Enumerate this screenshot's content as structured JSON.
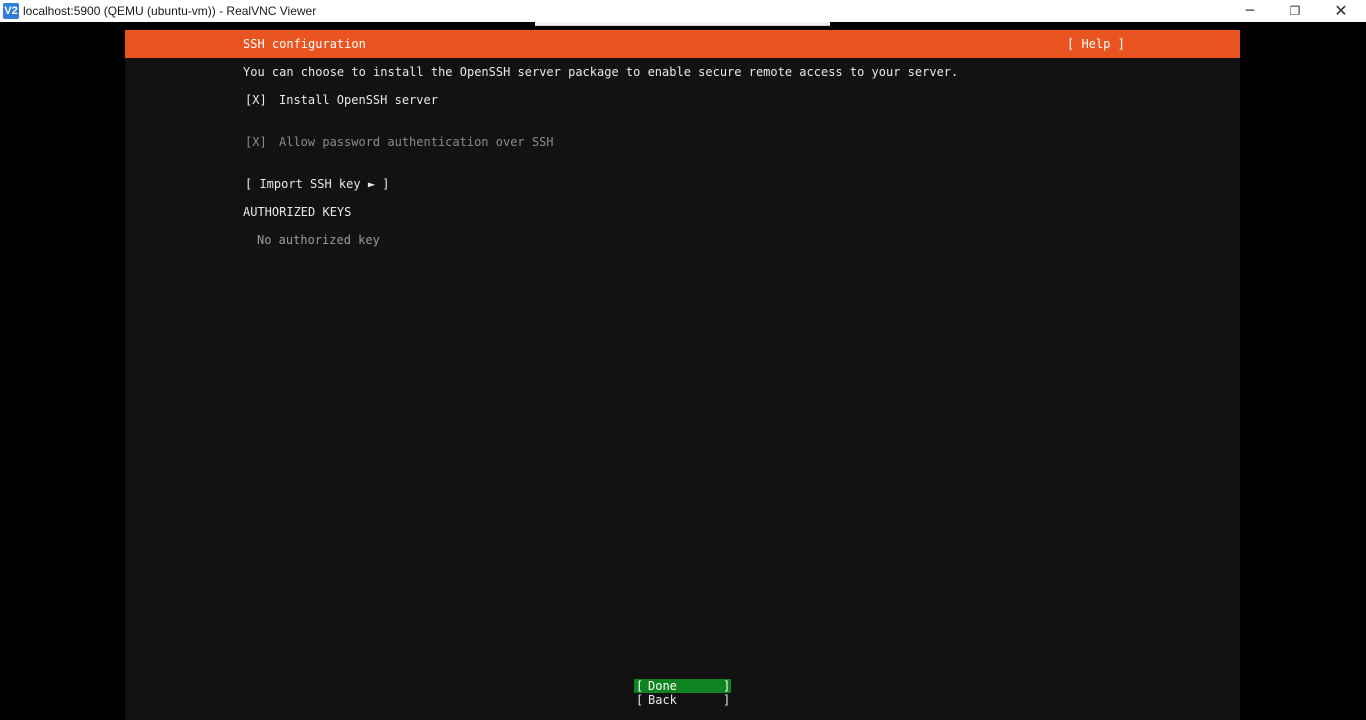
{
  "window": {
    "title": "localhost:5900 (QEMU (ubuntu-vm)) - RealVNC Viewer",
    "app_icon": "V2",
    "controls": {
      "minimize": "─",
      "maximize": "❐",
      "close": "✕"
    }
  },
  "installer": {
    "header": {
      "title": "SSH configuration",
      "help": "[ Help ]"
    },
    "intro": "You can choose to install the OpenSSH server package to enable secure remote access to your server.",
    "options": [
      {
        "checkbox": "[X]",
        "label": "Install OpenSSH server",
        "enabled": true
      },
      {
        "checkbox": "[X]",
        "label": "Allow password authentication over SSH",
        "enabled": false
      }
    ],
    "import_key": "[ Import SSH key ► ]",
    "authorized_keys": {
      "heading": "AUTHORIZED KEYS",
      "empty": "No authorized key"
    },
    "buttons": {
      "done": {
        "open": "[",
        "label": "Done",
        "close": "]"
      },
      "back": {
        "open": "[",
        "label": "Back",
        "close": "]"
      }
    }
  },
  "colors": {
    "header": "#e95420",
    "background": "#121212",
    "done_highlight": "#0e8420"
  }
}
